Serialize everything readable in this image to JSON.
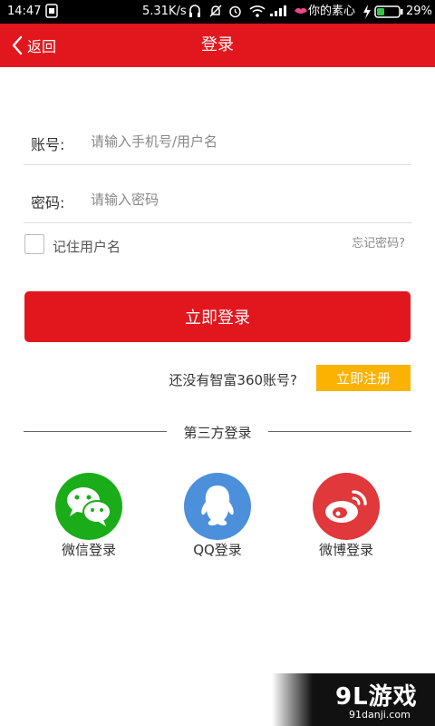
{
  "status_bar": {
    "time": "14:47",
    "speed": "5.31K/s",
    "carrier": "你的素心",
    "battery": "29%"
  },
  "app_bar": {
    "back_label": "返回",
    "title": "登录"
  },
  "form": {
    "account_label": "账号:",
    "account_placeholder": "请输入手机号/用户名",
    "password_label": "密码:",
    "password_placeholder": "请输入密码",
    "remember_label": "记住用户名",
    "forgot_label": "忘记密码?",
    "login_button": "立即登录"
  },
  "register": {
    "prompt": "还没有智富360账号?",
    "button": "立即注册"
  },
  "third_party": {
    "title": "第三方登录",
    "items": [
      {
        "label": "微信登录",
        "icon": "wechat-icon",
        "color": "#1aad19"
      },
      {
        "label": "QQ登录",
        "icon": "qq-icon",
        "color": "#4c8fdb"
      },
      {
        "label": "微博登录",
        "icon": "weibo-icon",
        "color": "#e0383b"
      }
    ]
  },
  "watermark": {
    "logo": "9L游戏",
    "site": "91danji.com"
  },
  "colors": {
    "brand_red": "#e2171e",
    "register_orange": "#fbb200"
  }
}
